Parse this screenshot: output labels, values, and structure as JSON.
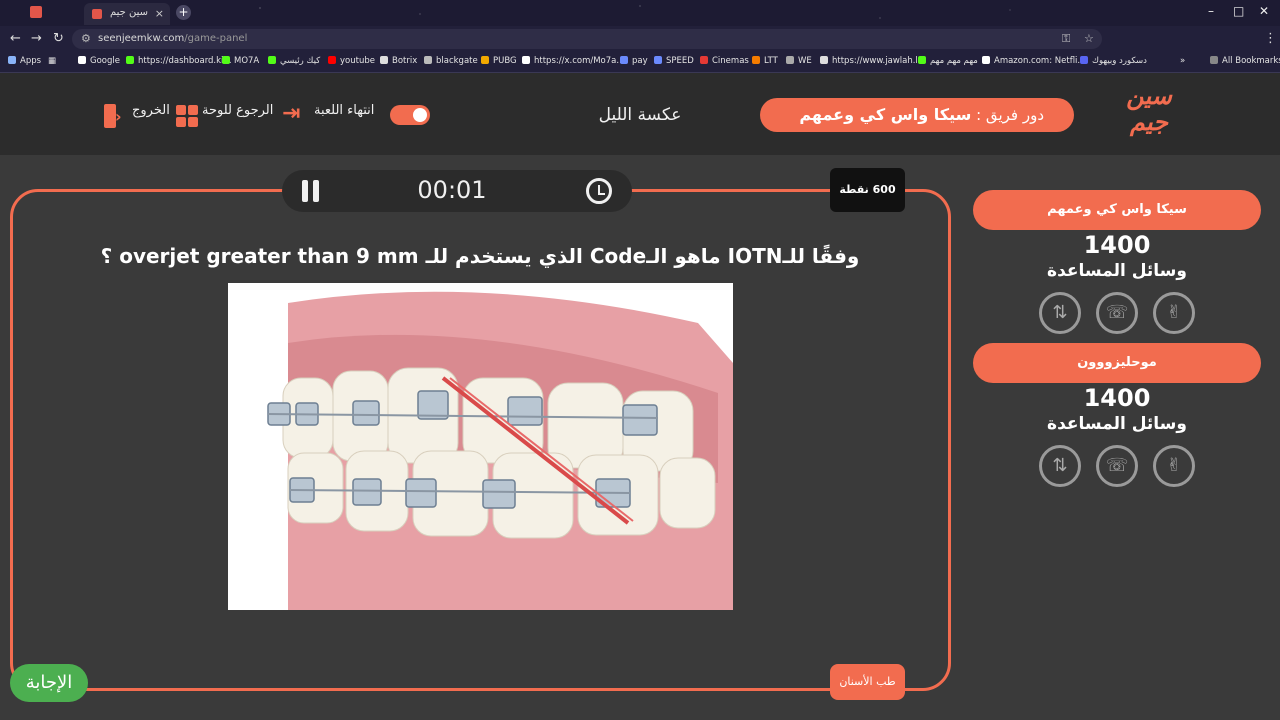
{
  "browser": {
    "tab_title": "سين جيم",
    "url_host": "seenjeemkw.com",
    "url_path": "/game-panel",
    "bookmarks": [
      "Apps",
      "Google",
      "https://dashboard.ki...",
      "MO7A",
      "كيك رئيسي",
      "youtube",
      "Botrix",
      "blackgate",
      "PUBG",
      "https://x.com/Mo7a...",
      "pay",
      "SPEED",
      "Cinemas",
      "LTT",
      "WE",
      "https://www.jawlah.l...",
      "مهم مهم مهم",
      "Amazon.com: Netfli...",
      "دسكورد وبيهوك",
      "All Bookmarks"
    ]
  },
  "header": {
    "logo_line1": "سين",
    "logo_line2": "جيم",
    "turn_prefix": "دور فريق : ",
    "turn_team": "سيكا واس كي وعمهم",
    "game_name": "عكسة الليل",
    "end_game_label": "انتهاء اللعبة",
    "back_to_board_label": "الرجوع للوحة",
    "exit_label": "الخروج"
  },
  "question": {
    "timer": "00:01",
    "points": "600 نقطة",
    "text": "وفقًا للـIOTN ماهو الـCode الذي يستخدم للـ overjet greater than 9 mm ؟",
    "category": "طب الأسنان",
    "answer_label": "الإجابة"
  },
  "teams": [
    {
      "name": "سيكا واس كي وعمهم",
      "score": "1400",
      "help_label": "وسائل المساعدة"
    },
    {
      "name": "موحليزووون",
      "score": "1400",
      "help_label": "وسائل المساعدة"
    }
  ],
  "colors": {
    "accent": "#f26c4f",
    "background": "#3a3a3a",
    "header_bg": "#2c2c2c",
    "answer": "#4caf50"
  },
  "icons": {
    "help_1": "swap-icon",
    "help_2": "phone-icon",
    "help_3": "victory-hand-icon"
  }
}
